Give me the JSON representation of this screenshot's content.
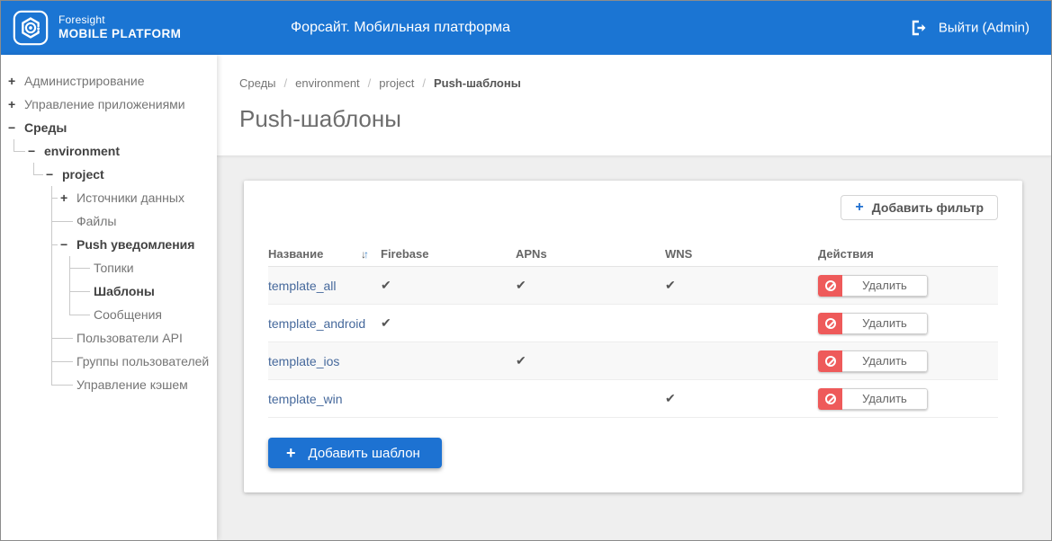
{
  "header": {
    "brand_top": "Foresight",
    "brand_bottom": "MOBILE PLATFORM",
    "app_title": "Форсайт. Мобильная платформа",
    "logout_label": "Выйти (Admin)"
  },
  "sidebar": {
    "items": [
      {
        "label": "Администрирование",
        "icon": "+",
        "level": 0,
        "expanded": false
      },
      {
        "label": "Управление приложениями",
        "icon": "+",
        "level": 0,
        "expanded": false
      },
      {
        "label": "Среды",
        "icon": "−",
        "level": 0,
        "expanded": true
      },
      {
        "label": "environment",
        "icon": "−",
        "level": 1,
        "expanded": true
      },
      {
        "label": "project",
        "icon": "−",
        "level": 2,
        "expanded": true
      },
      {
        "label": "Источники данных",
        "icon": "+",
        "level": 3,
        "expanded": false
      },
      {
        "label": "Файлы",
        "icon": "",
        "level": 3
      },
      {
        "label": "Push уведомления",
        "icon": "−",
        "level": 3,
        "expanded": true
      },
      {
        "label": "Топики",
        "icon": "",
        "level": 4
      },
      {
        "label": "Шаблоны",
        "icon": "",
        "level": 4,
        "selected": true
      },
      {
        "label": "Сообщения",
        "icon": "",
        "level": 4
      },
      {
        "label": "Пользователи API",
        "icon": "",
        "level": 3
      },
      {
        "label": "Группы пользователей",
        "icon": "",
        "level": 3
      },
      {
        "label": "Управление кэшем",
        "icon": "",
        "level": 3
      }
    ]
  },
  "breadcrumb": {
    "items": [
      "Среды",
      "environment",
      "project"
    ],
    "current": "Push-шаблоны",
    "separator": "/"
  },
  "page": {
    "title": "Push-шаблоны"
  },
  "toolbar": {
    "add_filter_label": "Добавить фильтр",
    "plus": "+"
  },
  "table": {
    "headers": {
      "name": "Название",
      "firebase": "Firebase",
      "apns": "APNs",
      "wns": "WNS",
      "actions": "Действия"
    },
    "sort_icon": {
      "down": "↓",
      "up": "↑"
    },
    "delete_label": "Удалить",
    "rows": [
      {
        "name": "template_all",
        "firebase": "✔",
        "apns": "✔",
        "wns": "✔"
      },
      {
        "name": "template_android",
        "firebase": "✔",
        "apns": "",
        "wns": ""
      },
      {
        "name": "template_ios",
        "firebase": "",
        "apns": "✔",
        "wns": ""
      },
      {
        "name": "template_win",
        "firebase": "",
        "apns": "",
        "wns": "✔"
      }
    ]
  },
  "footer_action": {
    "add_template_label": "Добавить шаблон",
    "plus": "+"
  },
  "colors": {
    "header_blue": "#1b75d3",
    "accent_blue": "#1d72d2",
    "link_blue": "#46699c",
    "danger_red": "#ee5a5a",
    "page_background": "#efefef"
  }
}
